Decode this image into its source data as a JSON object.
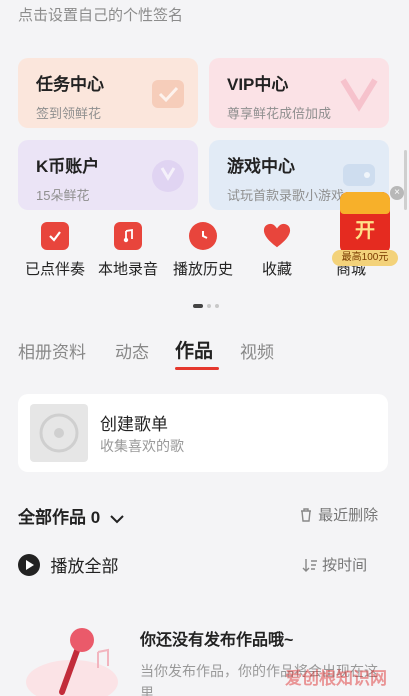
{
  "profile": {
    "signature_placeholder": "点击设置自己的个性签名"
  },
  "cards": [
    {
      "title": "任务中心",
      "subtitle": "签到领鲜花",
      "icon": "check-box-icon",
      "color": "#fbe6dc"
    },
    {
      "title": "VIP中心",
      "subtitle": "尊享鲜花成倍加成",
      "icon": "vip-chevron-icon",
      "color": "#fbe2e6"
    },
    {
      "title": "K币账户",
      "subtitle": "15朵鲜花",
      "icon": "coin-icon",
      "color": "#ebe4f6"
    },
    {
      "title": "游戏中心",
      "subtitle": "试玩首款录歌小游戏",
      "icon": "gamepad-icon",
      "color": "#e2ebf6"
    }
  ],
  "quick_actions": [
    {
      "label": "已点伴奏",
      "icon": "accompaniment-icon"
    },
    {
      "label": "本地录音",
      "icon": "music-note-icon"
    },
    {
      "label": "播放历史",
      "icon": "clock-icon"
    },
    {
      "label": "收藏",
      "icon": "heart-icon"
    },
    {
      "label": "商城",
      "icon": "shop-icon"
    }
  ],
  "promo": {
    "char": "开",
    "badge": "最高100元",
    "close": "×"
  },
  "tabs": [
    {
      "label": "相册资料",
      "active": false
    },
    {
      "label": "动态",
      "active": false
    },
    {
      "label": "作品",
      "active": true
    },
    {
      "label": "视频",
      "active": false
    }
  ],
  "playlist": {
    "title": "创建歌单",
    "subtitle": "收集喜欢的歌"
  },
  "works": {
    "title": "全部作品",
    "count": "0",
    "recent_delete": "最近删除",
    "play_all": "播放全部",
    "sort": "按时间"
  },
  "empty_state": {
    "title": "你还没有发布作品哦~",
    "desc": "当你发布作品，你的作品将会出现在这里"
  },
  "watermark": "爱创根知识网",
  "colors": {
    "accent": "#e5382d",
    "background": "#f4f4f6"
  }
}
